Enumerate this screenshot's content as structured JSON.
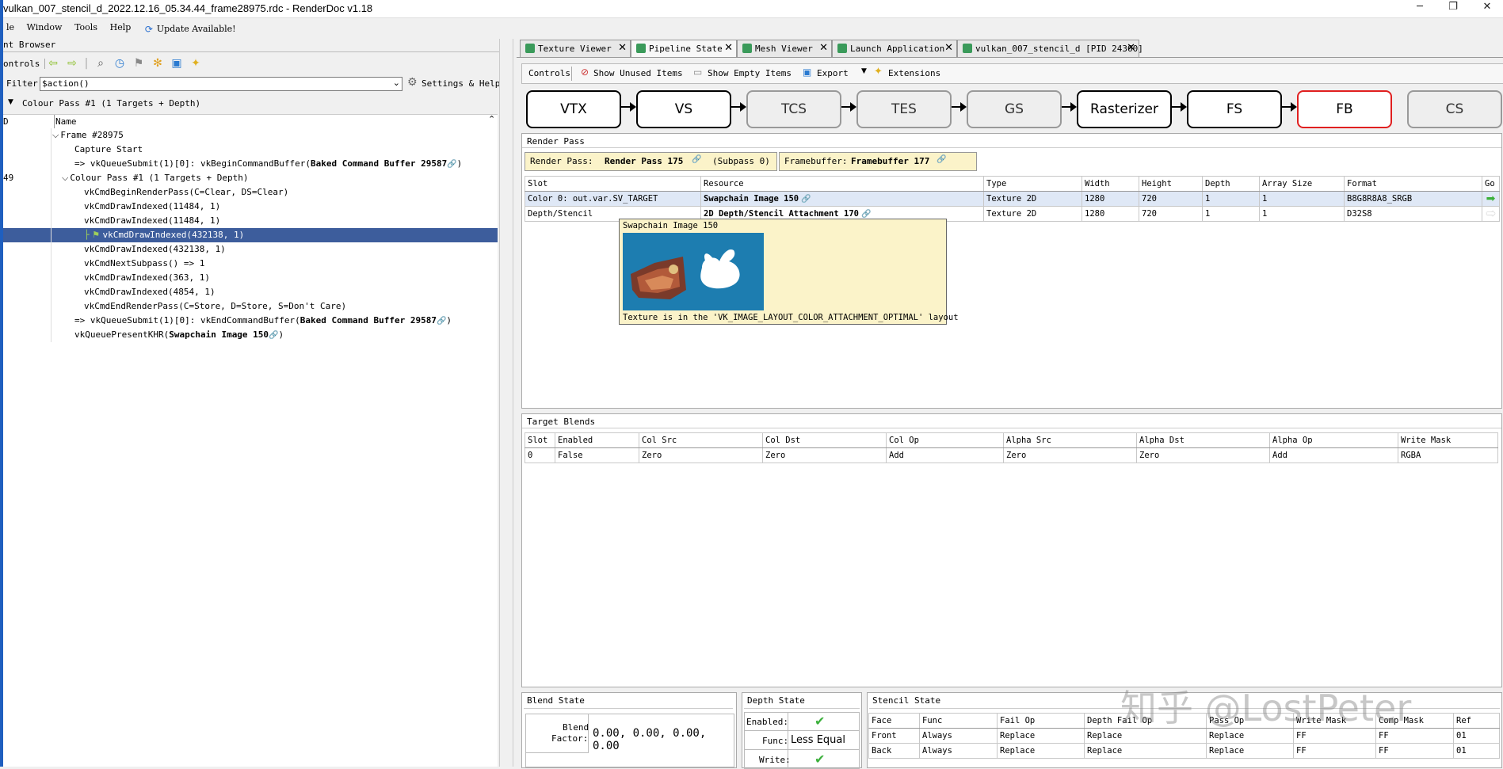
{
  "window": {
    "title": "vulkan_007_stencil_d_2022.12.16_05.34.44_frame28975.rdc - RenderDoc v1.18",
    "min_glyph": "─",
    "max_glyph": "❐",
    "close_glyph": "✕"
  },
  "menu": {
    "file": "le",
    "window": "Window",
    "tools": "Tools",
    "help": "Help",
    "update": "Update Available!"
  },
  "event_browser": {
    "title": "nt Browser",
    "controls_label": "ontrols",
    "filter_label": "Filter",
    "filter_value": "$action()",
    "settings_label": "Settings & Help",
    "breadcrumb": "Colour Pass #1 (1 Targets + Depth)",
    "col_eid": "D",
    "col_name": "Name",
    "rows": [
      {
        "num": "",
        "text": "Frame #28975",
        "indent": 62,
        "expander": "⌵"
      },
      {
        "num": "",
        "text": "Capture Start",
        "indent": 90
      },
      {
        "num": "",
        "text": "=>  vkQueueSubmit(1)[0]:  vkBeginCommandBuffer(",
        "bold": "Baked Command Buffer 29587",
        "tail": ")",
        "indent": 90,
        "link": true
      },
      {
        "num": "49",
        "text": "Colour Pass #1 (1 Targets + Depth)",
        "indent": 74,
        "expander": "⌵"
      },
      {
        "num": "",
        "text": "vkCmdBeginRenderPass(C=Clear, DS=Clear)",
        "indent": 102
      },
      {
        "num": "",
        "text": "vkCmdDrawIndexed(11484, 1)",
        "indent": 102
      },
      {
        "num": "",
        "text": "vkCmdDrawIndexed(11484, 1)",
        "indent": 102
      },
      {
        "num": "",
        "text": "vkCmdDrawIndexed(432138, 1)",
        "indent": 124,
        "selected": true
      },
      {
        "num": "",
        "text": "vkCmdDrawIndexed(432138, 1)",
        "indent": 102
      },
      {
        "num": "",
        "text": "vkCmdNextSubpass() => 1",
        "indent": 102
      },
      {
        "num": "",
        "text": "vkCmdDrawIndexed(363, 1)",
        "indent": 102
      },
      {
        "num": "",
        "text": "vkCmdDrawIndexed(4854, 1)",
        "indent": 102
      },
      {
        "num": "",
        "text": "vkCmdEndRenderPass(C=Store, D=Store, S=Don't Care)",
        "indent": 102
      },
      {
        "num": "",
        "text": "=>  vkQueueSubmit(1)[0]:  vkEndCommandBuffer(",
        "bold": "Baked Command Buffer 29587",
        "tail": ")",
        "indent": 90,
        "link": true
      },
      {
        "num": "",
        "text": "vkQueuePresentKHR(",
        "bold": "Swapchain Image 150",
        "tail": ")",
        "indent": 90,
        "link": true
      }
    ]
  },
  "tabs": [
    {
      "label": "Texture Viewer",
      "left": 0
    },
    {
      "label": "Pipeline State"
    },
    {
      "label": "Mesh Viewer"
    },
    {
      "label": "Launch Application"
    },
    {
      "label": "vulkan_007_stencil_d [PID 24360]"
    }
  ],
  "pipeline_toolbar": {
    "controls": "Controls",
    "show_unused": "Show Unused Items",
    "show_empty": "Show Empty Items",
    "export": "Export",
    "extensions": "Extensions"
  },
  "stages": [
    "VTX",
    "VS",
    "TCS",
    "TES",
    "GS",
    "Rasterizer",
    "FS",
    "FB",
    "CS"
  ],
  "render_pass": {
    "title": "Render Pass",
    "rp_label": "Render  Pass:",
    "rp_value": "Render Pass 175",
    "subpass": "(Subpass  0)",
    "fb_label": "Framebuffer:",
    "fb_value": "Framebuffer 177",
    "headers": [
      "Slot",
      "Resource",
      "Type",
      "Width",
      "Height",
      "Depth",
      "Array Size",
      "Format",
      "Go"
    ],
    "rows": [
      [
        "Color 0: out.var.SV_TARGET",
        "Swapchain Image 150",
        "Texture 2D",
        "1280",
        "720",
        "1",
        "1",
        "B8G8R8A8_SRGB"
      ],
      [
        "Depth/Stencil",
        "2D Depth/Stencil Attachment 170",
        "Texture 2D",
        "1280",
        "720",
        "1",
        "1",
        "D32S8"
      ]
    ]
  },
  "tooltip": {
    "title": "Swapchain Image 150",
    "note": "Texture is in the 'VK_IMAGE_LAYOUT_COLOR_ATTACHMENT_OPTIMAL' layout"
  },
  "target_blends": {
    "title": "Target Blends",
    "headers": [
      "Slot",
      "Enabled",
      "Col Src",
      "Col Dst",
      "Col Op",
      "Alpha Src",
      "Alpha Dst",
      "Alpha Op",
      "Write Mask"
    ],
    "rows": [
      [
        "0",
        "False",
        "Zero",
        "Zero",
        "Add",
        "Zero",
        "Zero",
        "Add",
        "RGBA"
      ]
    ]
  },
  "blend_state": {
    "title": "Blend State",
    "factor_label_1": "Blend",
    "factor_label_2": "Factor:",
    "factor_value": "0.00,  0.00,  0.00,  0.00"
  },
  "depth_state": {
    "title": "Depth State",
    "enabled_label": "Enabled:",
    "func_label": "Func:",
    "func_value": "Less Equal",
    "write_label": "Write:"
  },
  "stencil_state": {
    "title": "Stencil State",
    "headers": [
      "Face",
      "Func",
      "Fail Op",
      "Depth Fail Op",
      "Pass Op",
      "Write Mask",
      "Comp Mask",
      "Ref"
    ],
    "rows": [
      [
        "Front",
        "Always",
        "Replace",
        "Replace",
        "Replace",
        "FF",
        "FF",
        "01"
      ],
      [
        "Back",
        "Always",
        "Replace",
        "Replace",
        "Replace",
        "FF",
        "FF",
        "01"
      ]
    ]
  },
  "watermark": "知乎 @LostPeter"
}
